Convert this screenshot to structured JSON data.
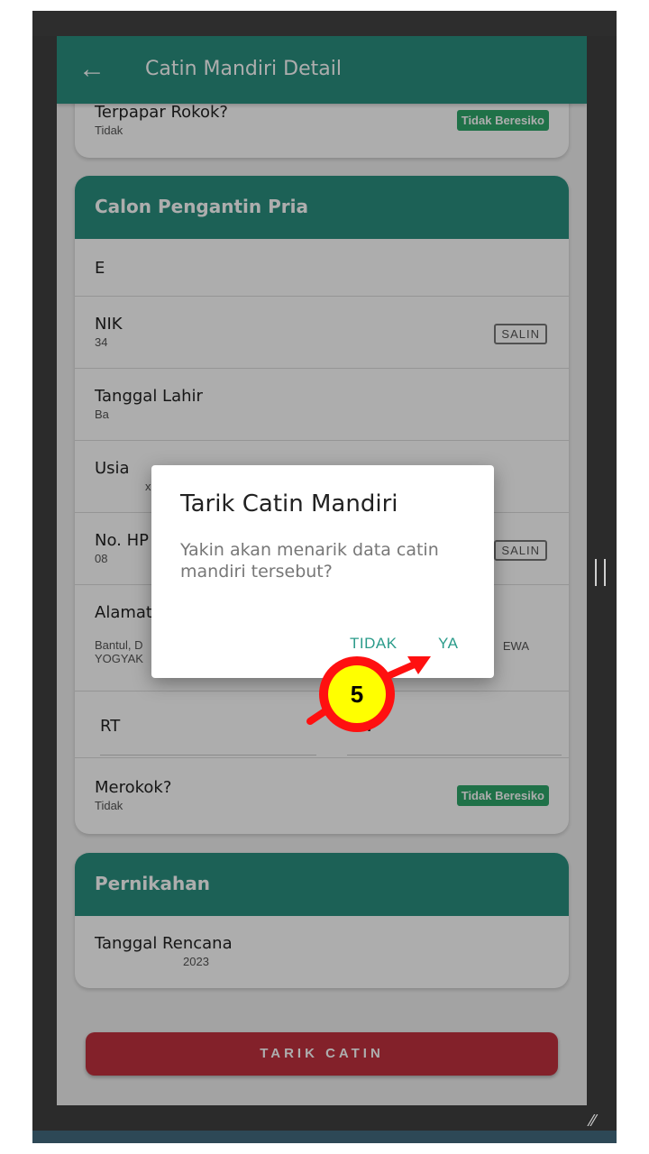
{
  "appbar": {
    "back_icon": "arrow-left-icon",
    "title": "Catin Mandiri Detail"
  },
  "top_card": {
    "label": "Terpapar Rokok?",
    "value": "Tidak",
    "badge": "Tidak Beresiko"
  },
  "groom_card": {
    "header": "Calon Pengantin Pria",
    "name_initial": "E",
    "nik_label": "NIK",
    "nik_value": "34",
    "copy_label": "SALIN",
    "dob_label": "Tanggal Lahir",
    "dob_value": "Ba",
    "age_label": "Usia",
    "age_value": "x",
    "phone_label": "No. HP",
    "phone_value": "08",
    "address_label": "Alamat",
    "address_value_1": "Bantul, D",
    "address_value_2": "YOGYAK",
    "address_suffix": "EWA",
    "rt_label": "RT",
    "rw_label": "RW",
    "smoke_label": "Merokok?",
    "smoke_value": "Tidak",
    "smoke_badge": "Tidak Beresiko"
  },
  "marriage_card": {
    "header": "Pernikahan",
    "plan_label": "Tanggal Rencana",
    "plan_value": "2023"
  },
  "action_button": "TARIK CATIN",
  "dialog": {
    "title": "Tarik Catin Mandiri",
    "message": "Yakin akan menarik data catin mandiri tersebut?",
    "cancel": "TIDAK",
    "confirm": "YA"
  },
  "annotation": {
    "step": "5",
    "color": "#ff1010",
    "fill": "#ffff00"
  },
  "colors": {
    "primary": "#2a8f7f",
    "danger": "#c2313f",
    "badge": "#2fa76a"
  }
}
